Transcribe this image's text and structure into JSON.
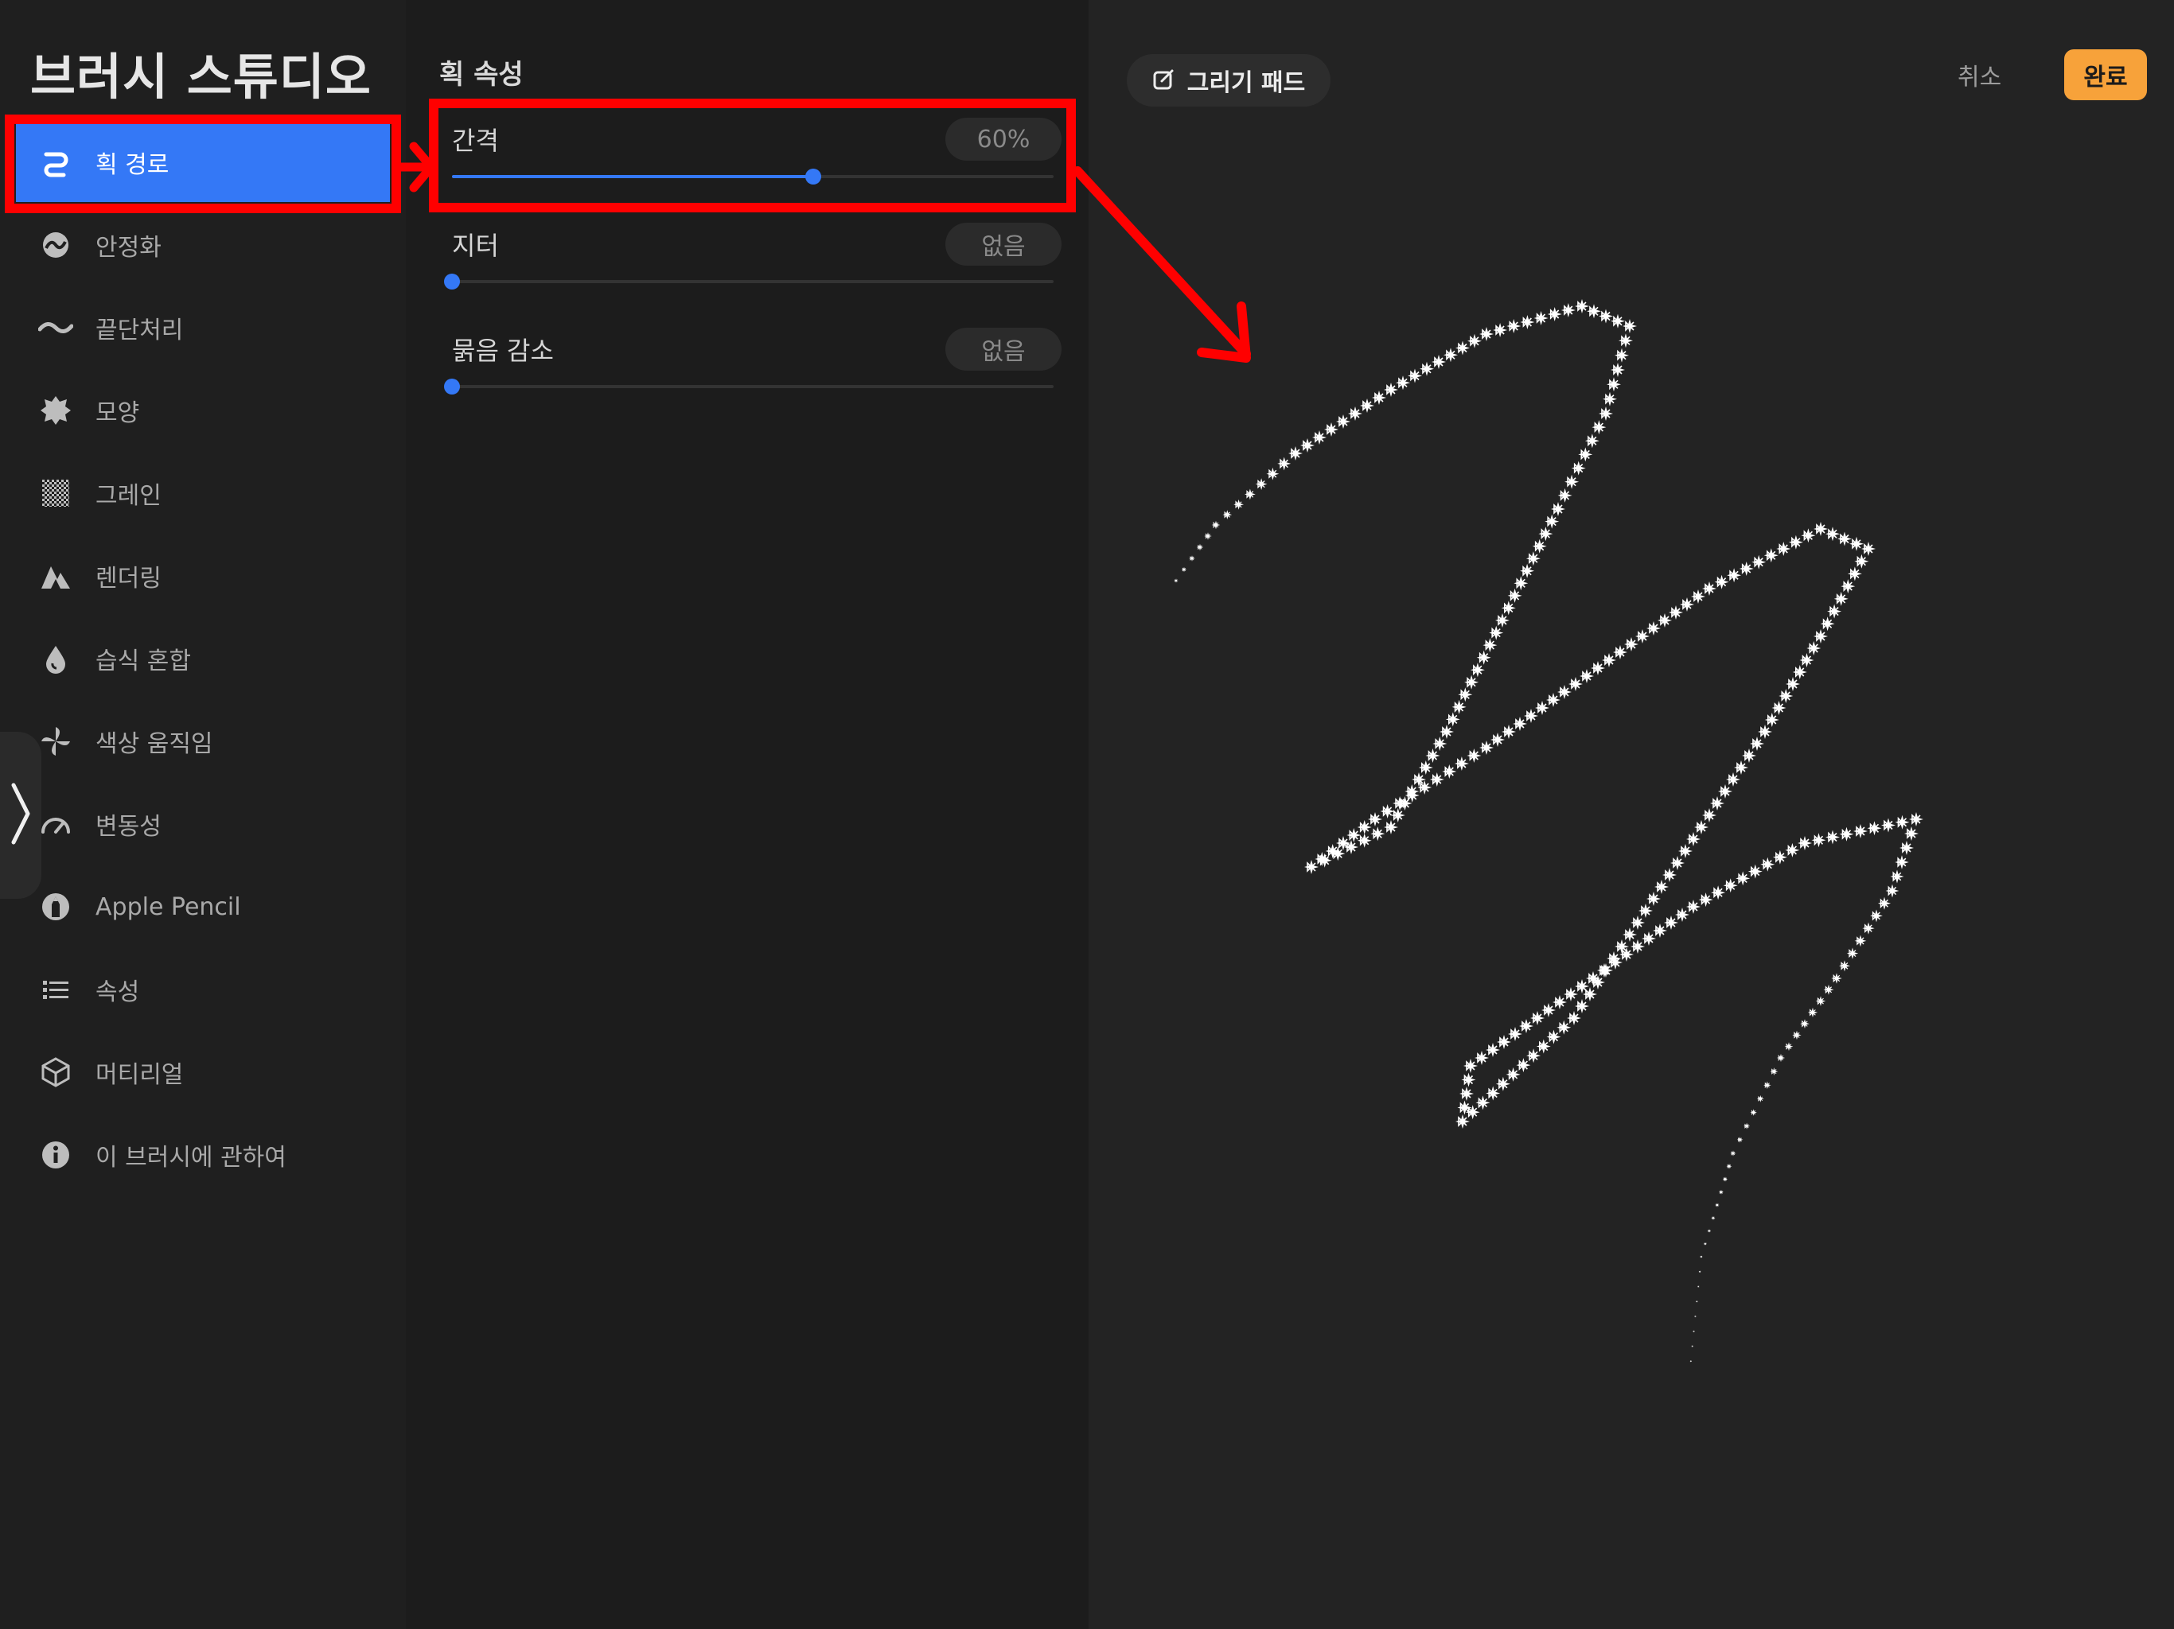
{
  "sidebar": {
    "title": "브러시 스튜디오",
    "items": [
      {
        "label": "획 경로",
        "icon": "stroke-path-icon",
        "active": true
      },
      {
        "label": "안정화",
        "icon": "stabilization-icon"
      },
      {
        "label": "끝단처리",
        "icon": "taper-icon"
      },
      {
        "label": "모양",
        "icon": "shape-icon"
      },
      {
        "label": "그레인",
        "icon": "grain-icon"
      },
      {
        "label": "렌더링",
        "icon": "rendering-icon"
      },
      {
        "label": "습식 혼합",
        "icon": "wet-mix-icon"
      },
      {
        "label": "색상 움직임",
        "icon": "color-dynamics-icon"
      },
      {
        "label": "변동성",
        "icon": "dynamics-icon"
      },
      {
        "label": "Apple Pencil",
        "icon": "apple-pencil-icon"
      },
      {
        "label": "속성",
        "icon": "properties-icon"
      },
      {
        "label": "머티리얼",
        "icon": "materials-icon"
      },
      {
        "label": "이 브러시에 관하여",
        "icon": "about-icon"
      }
    ]
  },
  "properties": {
    "section_title": "획 속성",
    "spacing": {
      "label": "간격",
      "value": "60%",
      "fraction": 0.6
    },
    "jitter": {
      "label": "지터",
      "value": "없음",
      "fraction": 0.0
    },
    "falloff": {
      "label": "묽음 감소",
      "value": "없음",
      "fraction": 0.0
    }
  },
  "canvas": {
    "drawing_pad_label": "그리기 패드",
    "cancel_label": "취소",
    "done_label": "완료"
  },
  "colors": {
    "accent": "#3478f6",
    "done_button": "#f7a23a",
    "annotation": "#ff0000",
    "stroke": "#ffffff"
  }
}
